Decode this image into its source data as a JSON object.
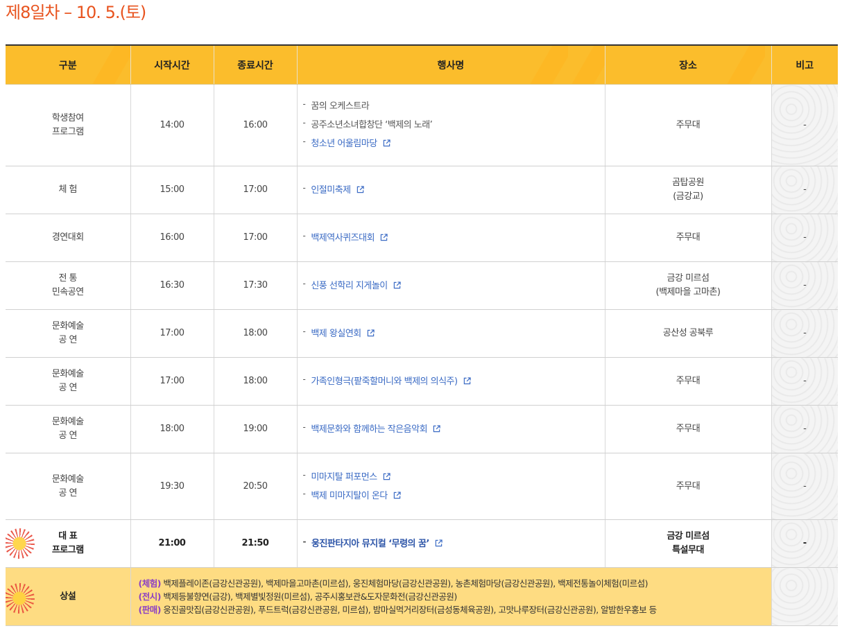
{
  "title": "제8일차 – 10. 5.(토)",
  "headers": [
    "구분",
    "시작시간",
    "종료시간",
    "행사명",
    "장소",
    "비고"
  ],
  "rows": [
    {
      "category": [
        "학생참여",
        "프로그램"
      ],
      "start": "14:00",
      "end": "16:00",
      "events": [
        {
          "name": "꿈의 오케스트라",
          "link": false
        },
        {
          "name": "공주소년소녀합창단 ‘백제의 노래’",
          "link": false
        },
        {
          "name": "청소년 어울림마당",
          "link": true
        }
      ],
      "place": [
        "주무대"
      ],
      "note": "-"
    },
    {
      "category": [
        "체 험"
      ],
      "start": "15:00",
      "end": "17:00",
      "events": [
        {
          "name": "인절미축제",
          "link": true
        }
      ],
      "place": [
        "곰탑공원",
        "(금강교)"
      ],
      "note": "-"
    },
    {
      "category": [
        "경연대회"
      ],
      "start": "16:00",
      "end": "17:00",
      "events": [
        {
          "name": "백제역사퀴즈대회",
          "link": true
        }
      ],
      "place": [
        "주무대"
      ],
      "note": "-"
    },
    {
      "category": [
        "전 통",
        "민속공연"
      ],
      "start": "16:30",
      "end": "17:30",
      "events": [
        {
          "name": "신풍 선학리 지게놀이",
          "link": true
        }
      ],
      "place": [
        "금강 미르섬",
        "(백제마을 고마촌)"
      ],
      "note": "-"
    },
    {
      "category": [
        "문화예술",
        "공 연"
      ],
      "start": "17:00",
      "end": "18:00",
      "events": [
        {
          "name": "백제 왕실연회",
          "link": true
        }
      ],
      "place": [
        "공산성 공북루"
      ],
      "note": "-"
    },
    {
      "category": [
        "문화예술",
        "공 연"
      ],
      "start": "17:00",
      "end": "18:00",
      "events": [
        {
          "name": "가족인형극(팥죽할머니와 백제의 의식주)",
          "link": true
        }
      ],
      "place": [
        "주무대"
      ],
      "note": "-"
    },
    {
      "category": [
        "문화예술",
        "공 연"
      ],
      "start": "18:00",
      "end": "19:00",
      "events": [
        {
          "name": "백제문화와 함께하는 작은음악회",
          "link": true
        }
      ],
      "place": [
        "주무대"
      ],
      "note": "-"
    },
    {
      "category": [
        "문화예술",
        "공 연"
      ],
      "start": "19:30",
      "end": "20:50",
      "events": [
        {
          "name": "미마지탈 퍼포먼스",
          "link": true
        },
        {
          "name": "백제 미마지탈이 온다",
          "link": true
        }
      ],
      "place": [
        "주무대"
      ],
      "note": "-"
    }
  ],
  "representative": {
    "category": [
      "대 표",
      "프로그램"
    ],
    "start": "21:00",
    "end": "21:50",
    "event": "웅진판타지아 뮤지컬 ‘무령의 꿈’",
    "place": [
      "금강 미르섬",
      "특설무대"
    ],
    "note": "-"
  },
  "permanent": {
    "category": "상설",
    "lines": [
      {
        "tag": "(체험)",
        "text": " 백제플레이존(금강신관공원), 백제마을고마촌(미르섬), 웅진체험마당(금강신관공원), 농촌체험마당(금강신관공원), 백제전통놀이체험(미르섬)"
      },
      {
        "tag": "(전시)",
        "text": " 백제등불향연(금강), 백제별빛정원(미르섬), 공주시홍보관&도자문화전(금강신관공원)"
      },
      {
        "tag": "(판매)",
        "text": " 웅진골맛집(금강신관공원), 푸드트럭(금강신관공원, 미르섬), 밤마실먹거리장터(금성동체육공원), 고맛나루장터(금강신관공원), 알밤한우홍보 등"
      }
    ]
  },
  "colors": {
    "title": "#e8531e",
    "header_bg": "#fbbd2c",
    "link": "#3a6ac4",
    "permanent_bg": "#fedc82",
    "tag": "#8b3fc4"
  },
  "icons": {
    "external_link": "external-link-icon"
  }
}
